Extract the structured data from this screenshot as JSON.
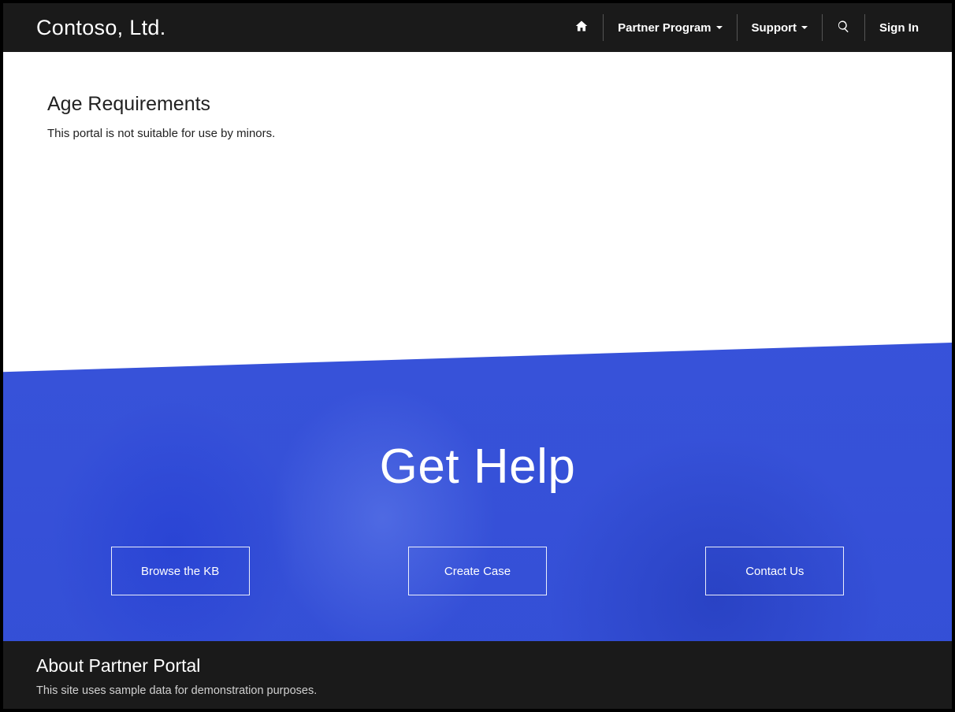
{
  "brand": "Contoso, Ltd.",
  "nav": {
    "partner_program": "Partner Program",
    "support": "Support",
    "sign_in": "Sign In"
  },
  "page": {
    "title": "Age Requirements",
    "text": "This portal is not suitable for use by minors."
  },
  "hero": {
    "title": "Get Help",
    "buttons": {
      "browse_kb": "Browse the KB",
      "create_case": "Create Case",
      "contact_us": "Contact Us"
    }
  },
  "footer": {
    "title": "About Partner Portal",
    "text": "This site uses sample data for demonstration purposes."
  }
}
